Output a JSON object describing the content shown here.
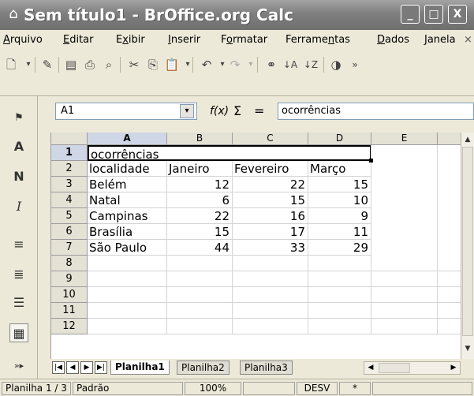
{
  "window": {
    "title": "Sem título1 - BrOffice.org Calc",
    "buttons": {
      "minimize": "_",
      "maximize": "□",
      "close": "X"
    }
  },
  "menu": [
    {
      "pre": "",
      "u": "A",
      "post": "rquivo"
    },
    {
      "pre": "",
      "u": "E",
      "post": "ditar"
    },
    {
      "pre": "E",
      "u": "x",
      "post": "ibir"
    },
    {
      "pre": "",
      "u": "I",
      "post": "nserir"
    },
    {
      "pre": "F",
      "u": "o",
      "post": "rmatar"
    },
    {
      "pre": "Ferrame",
      "u": "n",
      "post": "tas"
    },
    {
      "pre": "",
      "u": "D",
      "post": "ados"
    },
    {
      "pre": "",
      "u": "J",
      "post": "anela"
    }
  ],
  "menu_close": "×",
  "formula": {
    "cell_ref": "A1",
    "fx": "f(x)",
    "sigma": "Σ",
    "equal": "=",
    "content": "ocorrências"
  },
  "columns": [
    "A",
    "B",
    "C",
    "D",
    "E"
  ],
  "rows": [
    {
      "n": "1",
      "a": "ocorrências",
      "b": "",
      "c": "",
      "d": ""
    },
    {
      "n": "2",
      "a": "localidade",
      "b": "Janeiro",
      "c": "Fevereiro",
      "d": "Março"
    },
    {
      "n": "3",
      "a": "Belém",
      "b": "12",
      "c": "22",
      "d": "15"
    },
    {
      "n": "4",
      "a": "Natal",
      "b": "6",
      "c": "15",
      "d": "10"
    },
    {
      "n": "5",
      "a": "Campinas",
      "b": "22",
      "c": "16",
      "d": "9"
    },
    {
      "n": "6",
      "a": "Brasília",
      "b": "15",
      "c": "17",
      "d": "11"
    },
    {
      "n": "7",
      "a": "São Paulo",
      "b": "44",
      "c": "33",
      "d": "29"
    },
    {
      "n": "8",
      "a": "",
      "b": "",
      "c": "",
      "d": ""
    },
    {
      "n": "9",
      "a": "",
      "b": "",
      "c": "",
      "d": ""
    },
    {
      "n": "10",
      "a": "",
      "b": "",
      "c": "",
      "d": ""
    },
    {
      "n": "11",
      "a": "",
      "b": "",
      "c": "",
      "d": ""
    },
    {
      "n": "12",
      "a": "",
      "b": "",
      "c": "",
      "d": ""
    }
  ],
  "sheets": [
    "Planilha1",
    "Planilha2",
    "Planilha3"
  ],
  "status": {
    "sheet": "Planilha 1 / 3",
    "style": "Padrão",
    "zoom": "100%",
    "mode": "DESV",
    "modified": "*"
  },
  "left_toolbar": {
    "font_a": "A",
    "bold": "N",
    "italic": "I"
  }
}
